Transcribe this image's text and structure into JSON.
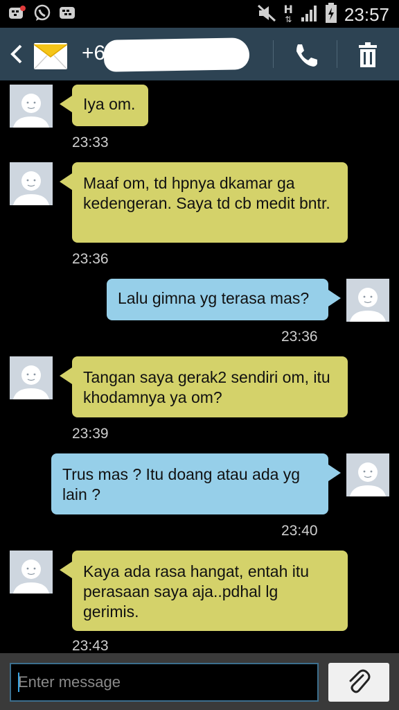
{
  "status_bar": {
    "time": "23:57",
    "network_type": "H",
    "icons_left": [
      "bbm-notification-icon",
      "whatsapp-icon",
      "bbm-icon"
    ],
    "icons_right": [
      "mute-icon",
      "network-h-icon",
      "signal-icon",
      "battery-charging-icon"
    ]
  },
  "header": {
    "contact": "+62",
    "redacted": true
  },
  "messages": [
    {
      "dir": "in",
      "text": "Iya om.",
      "time": "23:33"
    },
    {
      "dir": "in",
      "text": "Maaf om, td hpnya dkamar ga kedengeran. Saya td cb medit bntr.",
      "time": "23:36"
    },
    {
      "dir": "out",
      "text": "Lalu gimna yg terasa mas?",
      "time": "23:36"
    },
    {
      "dir": "in",
      "text": "Tangan saya gerak2 sendiri om, itu khodamnya ya om?",
      "time": "23:39"
    },
    {
      "dir": "out",
      "text": "Trus mas ? Itu doang atau ada yg lain ?",
      "time": "23:40"
    },
    {
      "dir": "in",
      "text": "Kaya ada rasa hangat, entah itu perasaan saya aja..pdhal lg gerimis.",
      "time": "23:43"
    }
  ],
  "composer": {
    "placeholder": "Enter message",
    "value": ""
  },
  "colors": {
    "incoming": "#d4d26a",
    "outgoing": "#96cfe9",
    "header": "#2d4353",
    "background": "#000000"
  }
}
